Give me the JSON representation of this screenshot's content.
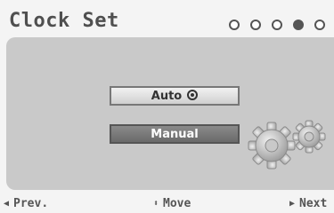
{
  "header": {
    "title": "Clock Set",
    "steps": {
      "total": 5,
      "current": 4
    }
  },
  "options": {
    "auto_label": "Auto",
    "auto_icon": "record-icon",
    "manual_label": "Manual",
    "selected": "Manual"
  },
  "footer": {
    "prev_label": "Prev.",
    "move_label": "Move",
    "next_label": "Next"
  },
  "colors": {
    "panel": "#c9c9c9",
    "selected_button": "#777777",
    "text": "#555555"
  },
  "icons": [
    "gears-icon",
    "left-arrow-icon",
    "up-down-arrow-icon",
    "right-arrow-icon"
  ]
}
